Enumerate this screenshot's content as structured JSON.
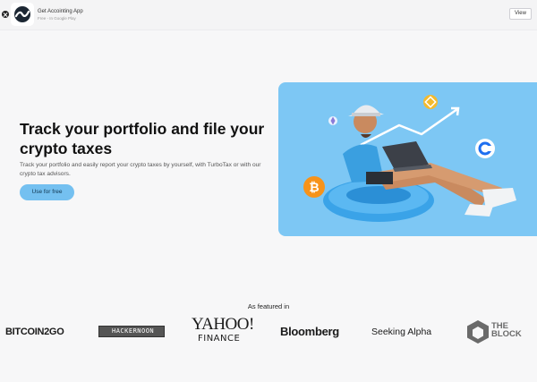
{
  "app_banner": {
    "name": "Get Accointing App",
    "subtitle": "Free - In Google Play",
    "view_label": "View"
  },
  "hero": {
    "title": "Track your portfolio and file your crypto taxes",
    "description": "Track your portfolio and easily report your crypto taxes by yourself, with TurboTax or with our crypto tax advisors.",
    "cta_label": "Use for free"
  },
  "featured": {
    "label": "As featured in",
    "logos": {
      "bitcoin2go": "BITCOIN2GO",
      "hackernoon": "HACKERNOON",
      "yahoo": "YAHOO!",
      "yahoo_sub": "FINANCE",
      "bloomberg": "Bloomberg",
      "seeking_alpha": "Seeking Alpha",
      "the_block_line1": "THE",
      "the_block_line2": "BLOCK"
    }
  },
  "colors": {
    "accent": "#74c0f0",
    "hero_bg": "#7dc7f4",
    "bitcoin": "#f7931a",
    "binance": "#f3ba2f",
    "coin_blue": "#1e6ff0"
  },
  "icons": [
    "close-icon",
    "accointing-logo-icon",
    "bitcoin-icon",
    "binance-icon",
    "ethereum-icon",
    "coin-c-icon",
    "chart-arrow-icon"
  ]
}
